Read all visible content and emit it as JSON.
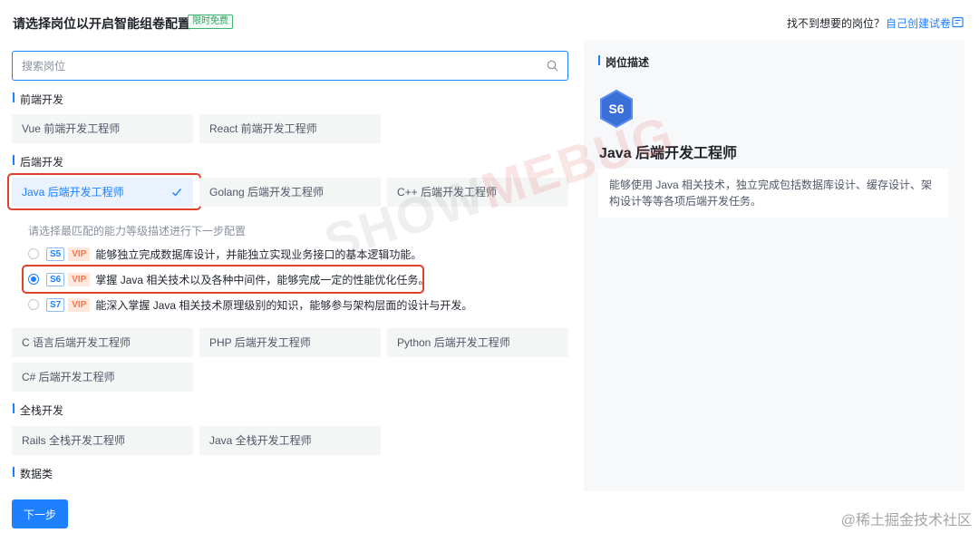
{
  "header": {
    "title": "请选择岗位以开启智能组卷配置",
    "free_badge": "限时免费",
    "not_found_text": "找不到想要的岗位？",
    "create_link": "自己创建试卷"
  },
  "search": {
    "placeholder": "搜索岗位",
    "value": ""
  },
  "sections": {
    "frontend": {
      "title": "前端开发",
      "items": [
        "Vue 前端开发工程师",
        "React 前端开发工程师"
      ]
    },
    "backend": {
      "title": "后端开发",
      "items": [
        "Java 后端开发工程师",
        "Golang 后端开发工程师",
        "C++ 后端开发工程师",
        "C 语言后端开发工程师",
        "PHP 后端开发工程师",
        "Python 后端开发工程师",
        "C# 后端开发工程师"
      ]
    },
    "fullstack": {
      "title": "全栈开发",
      "items": [
        "Rails 全栈开发工程师",
        "Java 全栈开发工程师"
      ]
    },
    "data": {
      "title": "数据类"
    }
  },
  "levels": {
    "hint": "请选择最匹配的能力等级描述进行下一步配置",
    "vip_label": "VIP",
    "selected": "S6",
    "items": [
      {
        "level": "S5",
        "text": "能够独立完成数据库设计，并能独立实现业务接口的基本逻辑功能。"
      },
      {
        "level": "S6",
        "text": "掌握 Java 相关技术以及各种中间件，能够完成一定的性能优化任务。"
      },
      {
        "level": "S7",
        "text": "能深入掌握 Java 相关技术原理级别的知识，能够参与架构层面的设计与开发。"
      }
    ]
  },
  "next_button": "下一步",
  "description": {
    "title": "岗位描述",
    "level": "S6",
    "job_name": "Java 后端开发工程师",
    "text": "能够使用 Java 相关技术，独立完成包括数据库设计、缓存设计、架构设计等等各项后端开发任务。"
  },
  "watermark": {
    "prefix": "SHOW",
    "suffix": "MEBUG"
  },
  "corner_watermark": "@稀土掘金技术社区",
  "colors": {
    "primary": "#1e80ff",
    "vip": "#ff7744",
    "free": "#2e9e5b",
    "highlight": "#e0412b"
  }
}
